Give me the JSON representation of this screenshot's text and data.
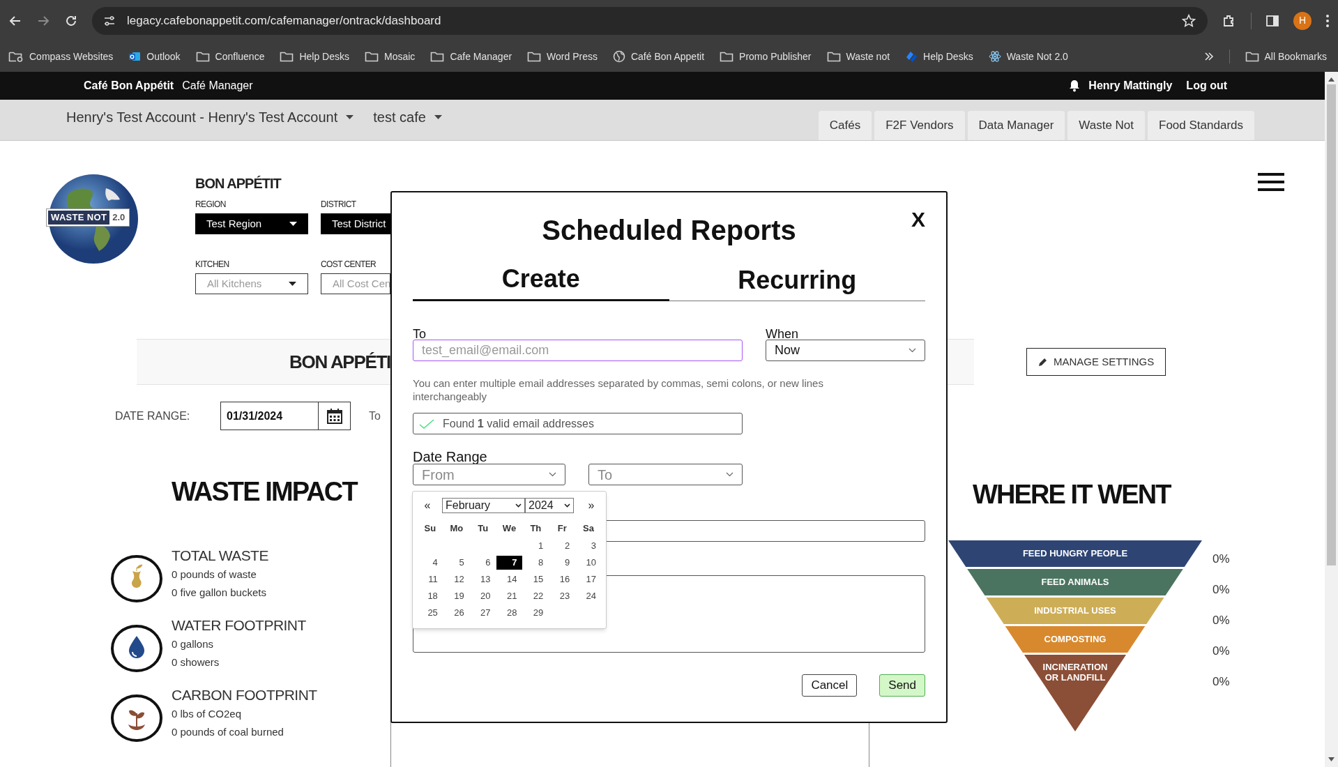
{
  "browser": {
    "url": "legacy.cafebonappetit.com/cafemanager/ontrack/dashboard",
    "profile_initial": "H",
    "bookmarks": [
      {
        "label": "Compass Websites",
        "kind": "folder-link"
      },
      {
        "label": "Outlook",
        "kind": "mail"
      },
      {
        "label": "Confluence",
        "kind": "folder"
      },
      {
        "label": "Help Desks",
        "kind": "folder"
      },
      {
        "label": "Mosaic",
        "kind": "folder"
      },
      {
        "label": "Cafe Manager",
        "kind": "folder"
      },
      {
        "label": "Word Press",
        "kind": "folder"
      },
      {
        "label": "Café Bon Appetit",
        "kind": "globe"
      },
      {
        "label": "Promo Publisher",
        "kind": "folder"
      },
      {
        "label": "Waste not",
        "kind": "folder"
      },
      {
        "label": "Help Desks",
        "kind": "app"
      },
      {
        "label": "Waste Not 2.0",
        "kind": "atom"
      }
    ],
    "all_bookmarks": "All Bookmarks"
  },
  "site_header": {
    "brand": "Café Bon Appétit",
    "app": "Café Manager",
    "user": "Henry Mattingly",
    "logout": "Log out"
  },
  "nav": {
    "account": "Henry's Test Account - Henry's Test Account",
    "cafe": "test cafe",
    "tabs": [
      {
        "label": "Cafés"
      },
      {
        "label": "F2F Vendors"
      },
      {
        "label": "Data Manager"
      },
      {
        "label": "Waste Not"
      },
      {
        "label": "Food Standards"
      }
    ]
  },
  "filters": {
    "logo_text": "WASTE NOT",
    "logo_version": "2.0",
    "brand": "BON APPÉTIT",
    "fields": [
      {
        "label": "REGION",
        "value": "Test Region",
        "kind": "dark"
      },
      {
        "label": "DISTRICT",
        "value": "Test District",
        "kind": "dark"
      },
      {
        "label": "KITCHEN",
        "value": "All Kitchens",
        "kind": "light"
      },
      {
        "label": "COST CENTER",
        "value": "All Cost Cen",
        "kind": "light"
      }
    ]
  },
  "banner": {
    "title": "BON APPÉTI"
  },
  "manage_settings": "MANAGE SETTINGS",
  "date_range": {
    "label": "DATE RANGE:",
    "from": "01/31/2024",
    "to_label": "To"
  },
  "waste_impact": {
    "title": "WASTE IMPACT",
    "items": [
      {
        "kind": "waste",
        "title": "TOTAL WASTE",
        "lines": [
          "0 pounds of waste",
          "0 five gallon buckets"
        ]
      },
      {
        "kind": "water",
        "title": "WATER FOOTPRINT",
        "lines": [
          "0 gallons",
          "0 showers"
        ]
      },
      {
        "kind": "carbon",
        "title": "CARBON FOOTPRINT",
        "lines": [
          "0 lbs of CO2eq",
          "0 pounds of coal burned"
        ]
      }
    ]
  },
  "where_it_went": {
    "title": "WHERE IT WENT",
    "levels": [
      {
        "label": "FEED HUNGRY PEOPLE",
        "color": "#2e4574",
        "percent": "0%"
      },
      {
        "label": "FEED ANIMALS",
        "color": "#4b7460",
        "percent": "0%"
      },
      {
        "label": "INDUSTRIAL USES",
        "color": "#cdae57",
        "percent": "0%"
      },
      {
        "label": "COMPOSTING",
        "color": "#d8892e",
        "percent": "0%"
      },
      {
        "label": "INCINERATION OR LANDFILL",
        "color": "#8b4e36",
        "percent": "0%"
      }
    ]
  },
  "modal": {
    "title": "Scheduled Reports",
    "close": "X",
    "tabs": [
      {
        "label": "Create",
        "selected": true
      },
      {
        "label": "Recurring",
        "selected": false
      }
    ],
    "to": {
      "label": "To",
      "placeholder": "test_email@email.com"
    },
    "when": {
      "label": "When",
      "value": "Now"
    },
    "hint": "You can enter multiple email addresses separated by commas, semi colons, or new lines interchangeably",
    "validation": "Found **1** valid email addresses",
    "date_range": {
      "label": "Date Range",
      "from_placeholder": "From",
      "to_placeholder": "To"
    },
    "datepicker": {
      "prev": "«",
      "next": "»",
      "month": "February",
      "year": "2024",
      "weekdays": [
        "Su",
        "Mo",
        "Tu",
        "We",
        "Th",
        "Fr",
        "Sa"
      ],
      "weeks": [
        {
          "kind": "first",
          "days": [
            {
              "day": "1",
              "selected": false
            },
            {
              "day": "2",
              "selected": false
            },
            {
              "day": "3",
              "selected": false
            }
          ]
        },
        {
          "kind": "full",
          "days": [
            {
              "day": "4",
              "selected": false
            },
            {
              "day": "5",
              "selected": false
            },
            {
              "day": "6",
              "selected": false
            },
            {
              "day": "7",
              "selected": true
            },
            {
              "day": "8",
              "selected": false
            },
            {
              "day": "9",
              "selected": false
            },
            {
              "day": "10",
              "selected": false
            }
          ]
        },
        {
          "kind": "full",
          "days": [
            {
              "day": "11",
              "selected": false
            },
            {
              "day": "12",
              "selected": false
            },
            {
              "day": "13",
              "selected": false
            },
            {
              "day": "14",
              "selected": false
            },
            {
              "day": "15",
              "selected": false
            },
            {
              "day": "16",
              "selected": false
            },
            {
              "day": "17",
              "selected": false
            }
          ]
        },
        {
          "kind": "full",
          "days": [
            {
              "day": "18",
              "selected": false
            },
            {
              "day": "19",
              "selected": false
            },
            {
              "day": "20",
              "selected": false
            },
            {
              "day": "21",
              "selected": false
            },
            {
              "day": "22",
              "selected": false
            },
            {
              "day": "23",
              "selected": false
            },
            {
              "day": "24",
              "selected": false
            }
          ]
        },
        {
          "kind": "last",
          "days": [
            {
              "day": "25",
              "selected": false
            },
            {
              "day": "26",
              "selected": false
            },
            {
              "day": "27",
              "selected": false
            },
            {
              "day": "28",
              "selected": false
            },
            {
              "day": "29",
              "selected": false
            }
          ]
        }
      ]
    },
    "buttons": [
      {
        "label": "Cancel",
        "kind": "secondary"
      },
      {
        "label": "Send",
        "kind": "primary"
      }
    ]
  }
}
